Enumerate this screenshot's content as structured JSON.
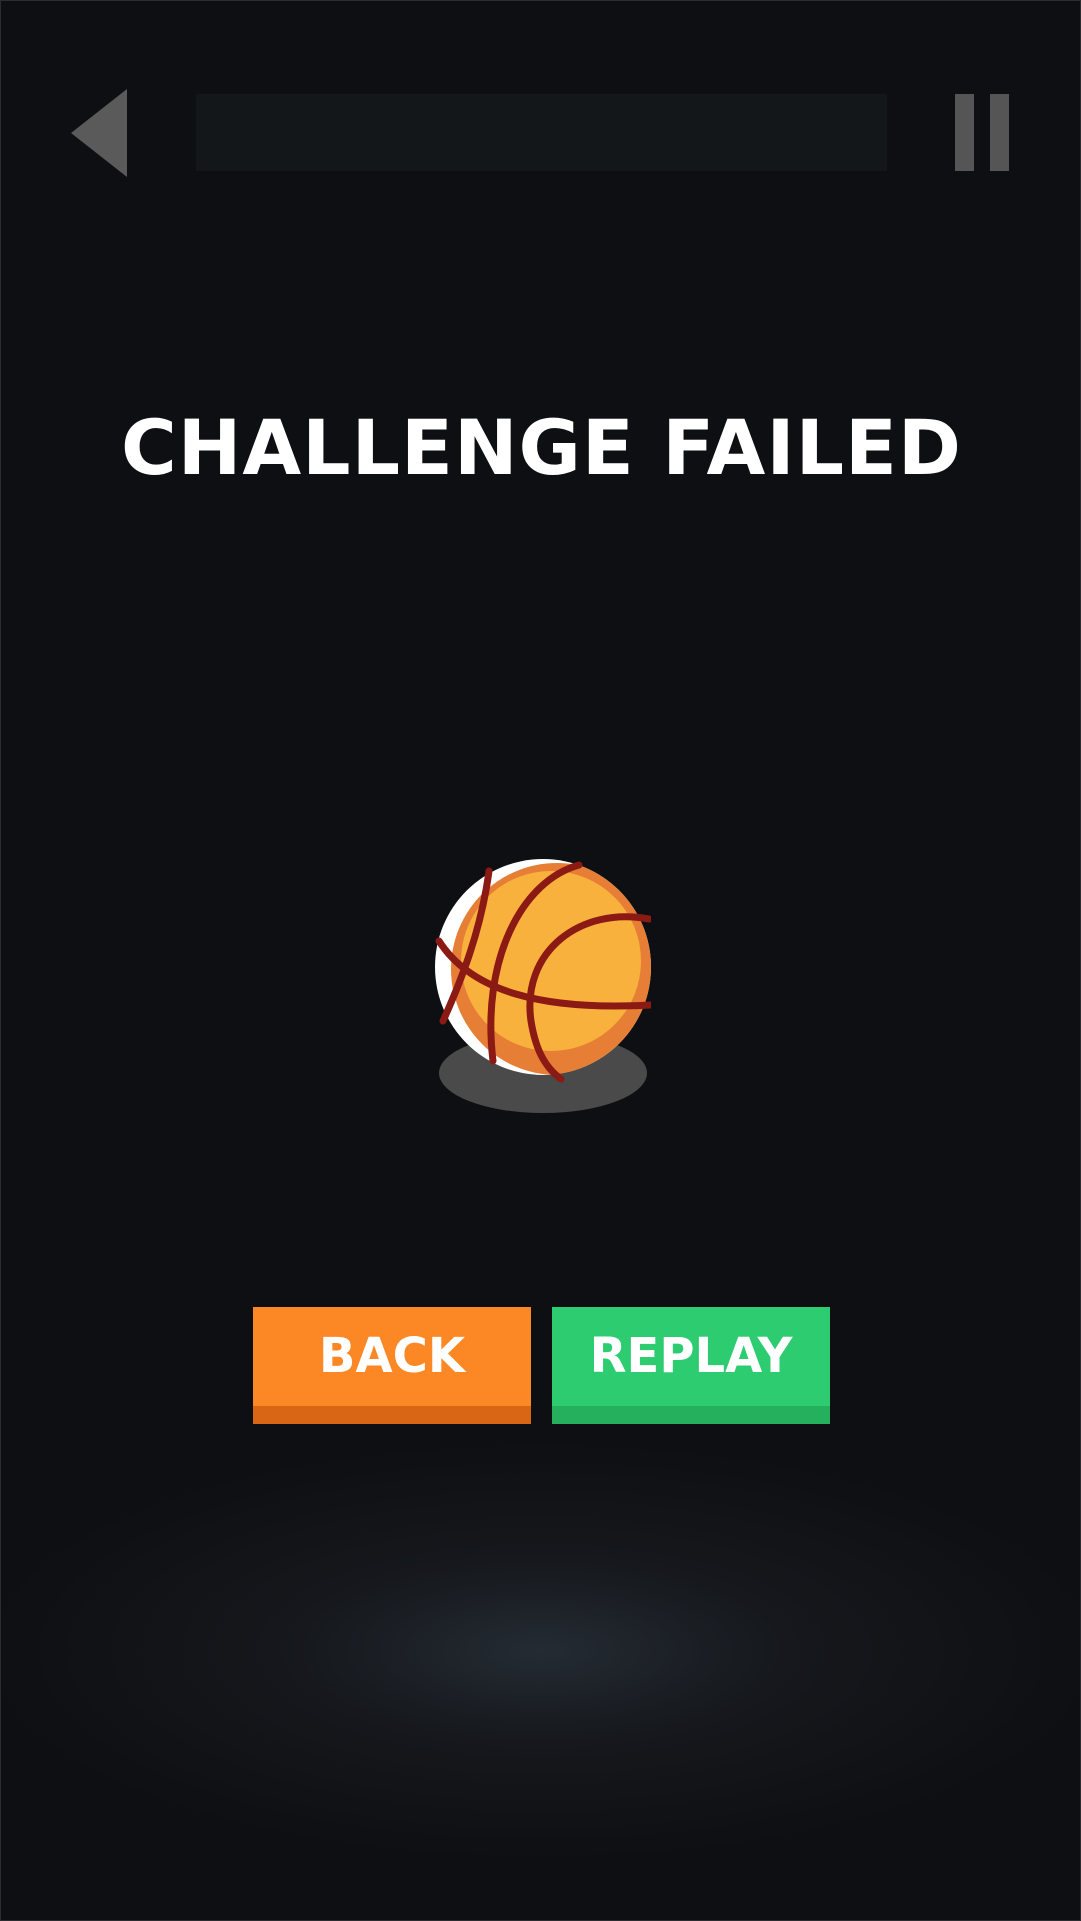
{
  "header": {
    "back_icon": "back-triangle-icon",
    "progress": 0,
    "pause_icon": "pause-icon"
  },
  "title": "CHALLENGE FAILED",
  "ball_icon": "basketball-icon",
  "buttons": {
    "back_label": "BACK",
    "replay_label": "REPLAY"
  },
  "colors": {
    "background": "#0e0f12",
    "back_button": "#fb8824",
    "replay_button": "#2ecc71",
    "ball": "#f9b13d",
    "ball_seams": "#8b1a14"
  }
}
